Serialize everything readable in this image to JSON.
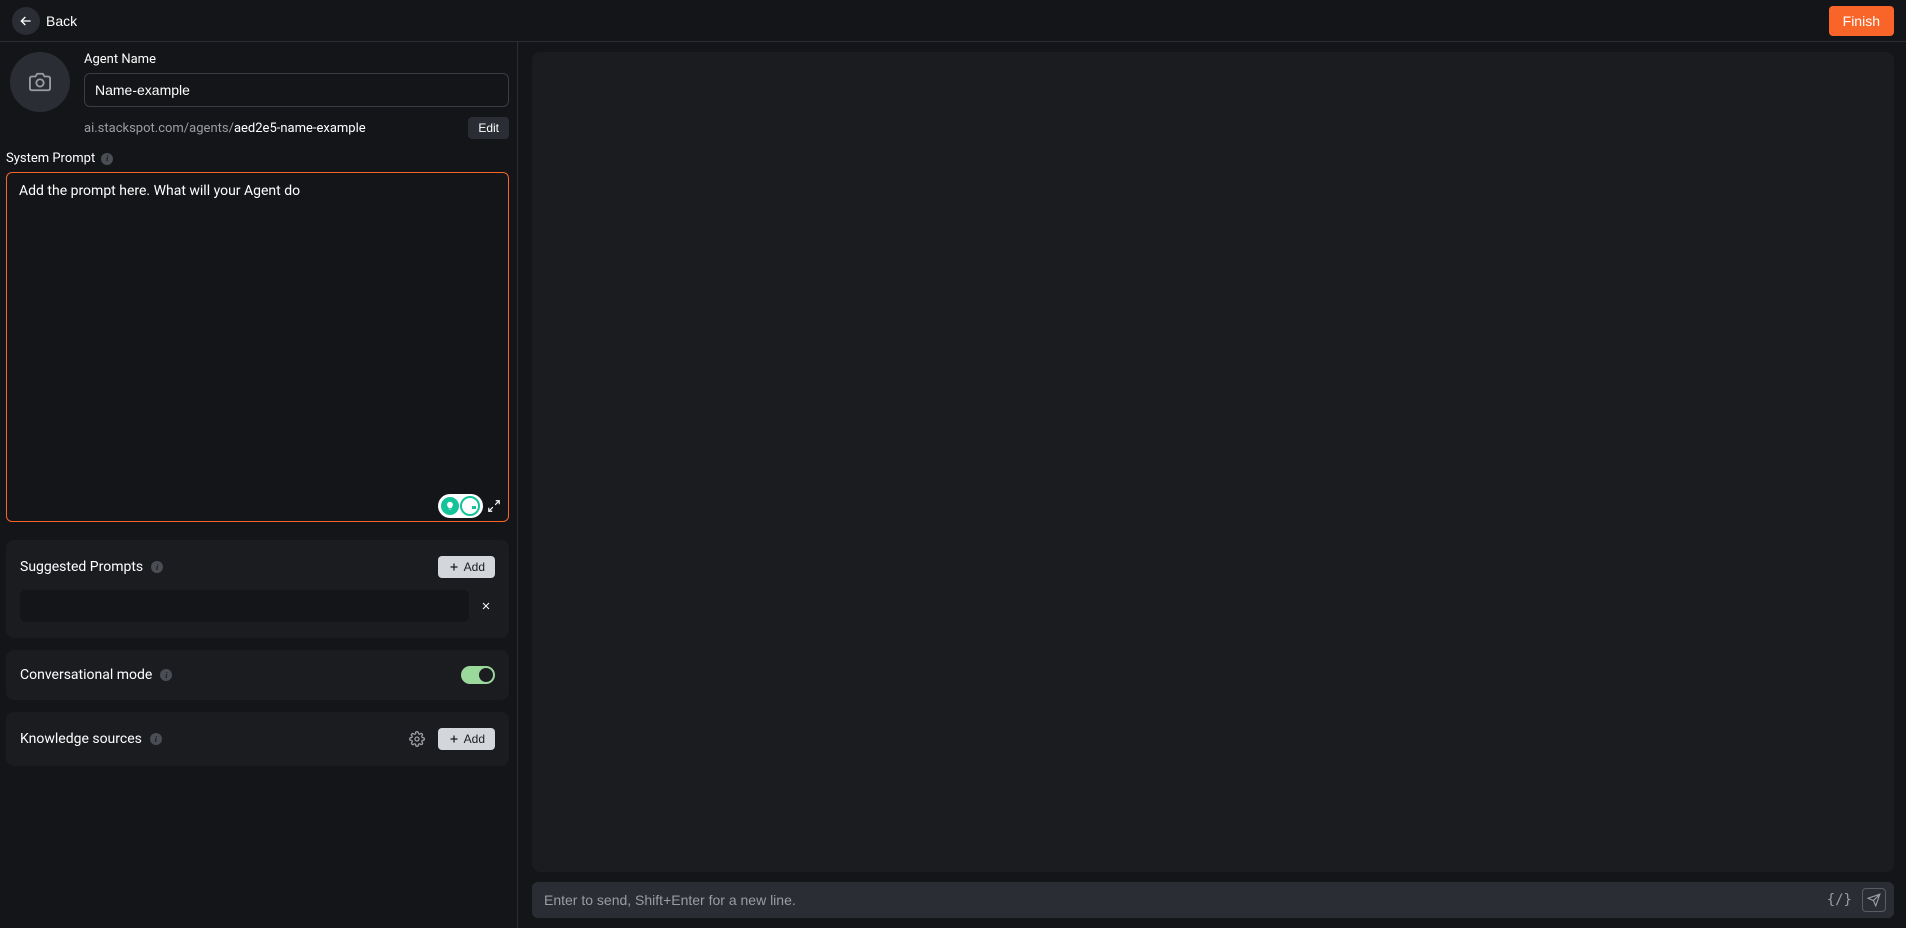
{
  "header": {
    "back_label": "Back",
    "finish_label": "Finish"
  },
  "agent": {
    "name_label": "Agent Name",
    "name_value": "Name-example",
    "url_prefix": "ai.stackspot.com/agents/",
    "url_slug": "aed2e5-name-example",
    "edit_label": "Edit"
  },
  "system_prompt": {
    "label": "System Prompt",
    "placeholder": "Add the prompt here. What will your Agent do"
  },
  "suggested_prompts": {
    "label": "Suggested Prompts",
    "add_label": "Add",
    "items": [
      {
        "value": ""
      }
    ]
  },
  "conversational_mode": {
    "label": "Conversational mode",
    "enabled": true
  },
  "knowledge_sources": {
    "label": "Knowledge sources",
    "add_label": "Add"
  },
  "chat": {
    "input_placeholder": "Enter to send, Shift+Enter for a new line.",
    "braces": "{/}"
  },
  "colors": {
    "accent": "#F96529",
    "toggle_on": "#9BD89B"
  }
}
